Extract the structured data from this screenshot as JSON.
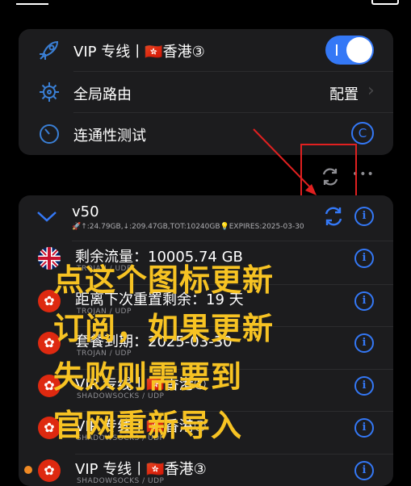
{
  "top_card": {
    "vip_row": {
      "label": "VIP 专线丨🇭🇰香港③",
      "toggle_on": true
    },
    "routing_row": {
      "label": "全局路由",
      "value": "配置",
      "chevron": "›"
    },
    "connectivity_row": {
      "label": "连通性测试",
      "badge": "C"
    }
  },
  "toolbar": {
    "more": "•••"
  },
  "subscription": {
    "name": "v50",
    "stats": "🚀↑:24.79GB,↓:209.47GB,TOT:10240GB💡EXPIRES:2025-03-30",
    "chevron": "∨"
  },
  "servers": [
    {
      "flag": "uk",
      "name": "剩余流量：10005.74 GB",
      "sub": "TROJAN / UDP"
    },
    {
      "flag": "hk",
      "name": "距离下次重置剩余：19 天",
      "sub": "TROJAN / UDP"
    },
    {
      "flag": "hk",
      "name": "套餐到期：2025-03-30",
      "sub": "TROJAN / UDP"
    },
    {
      "flag": "hk",
      "name": "VIP 专线丨🇭🇰香港①",
      "sub": "SHADOWSOCKS / UDP"
    },
    {
      "flag": "hk",
      "name": "VIP 专线丨🇭🇰香港②",
      "sub": "SHADOWSOCKS / UDP"
    },
    {
      "flag": "hk",
      "name": "VIP 专线丨🇭🇰香港③",
      "sub": "SHADOWSOCKS / UDP"
    }
  ],
  "annotation": {
    "lines": [
      "点这个图标更新",
      "订阅，如果更新",
      "失败则需要到",
      "官网重新导入"
    ]
  },
  "icons": {
    "info": "i",
    "hk_flag": "✿"
  },
  "colors": {
    "accent": "#3478f6",
    "annotation": "#f7c323",
    "highlight": "#e02020"
  }
}
